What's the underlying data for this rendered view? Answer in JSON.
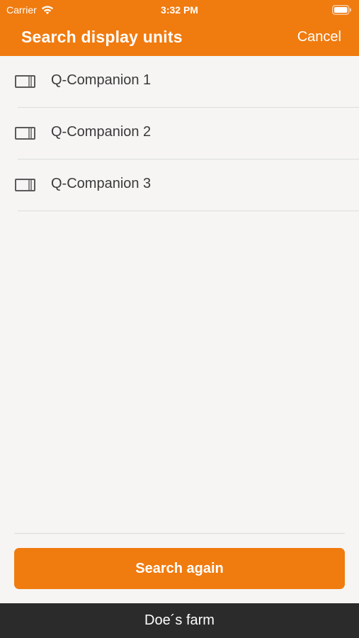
{
  "status_bar": {
    "carrier": "Carrier",
    "time": "3:32 PM",
    "icons": [
      "wifi-icon",
      "battery-icon"
    ]
  },
  "nav": {
    "title": "Search display units",
    "cancel_label": "Cancel"
  },
  "devices": [
    {
      "label": "Q-Companion 1",
      "icon": "display-unit-icon"
    },
    {
      "label": "Q-Companion 2",
      "icon": "display-unit-icon"
    },
    {
      "label": "Q-Companion 3",
      "icon": "display-unit-icon"
    }
  ],
  "actions": {
    "search_again_label": "Search again"
  },
  "footer": {
    "farm_name": "Doe´s farm"
  },
  "colors": {
    "accent": "#f07b0f",
    "background": "#f6f5f4",
    "footer_bar": "#2b2b2b",
    "text": "#3a3a3a"
  }
}
